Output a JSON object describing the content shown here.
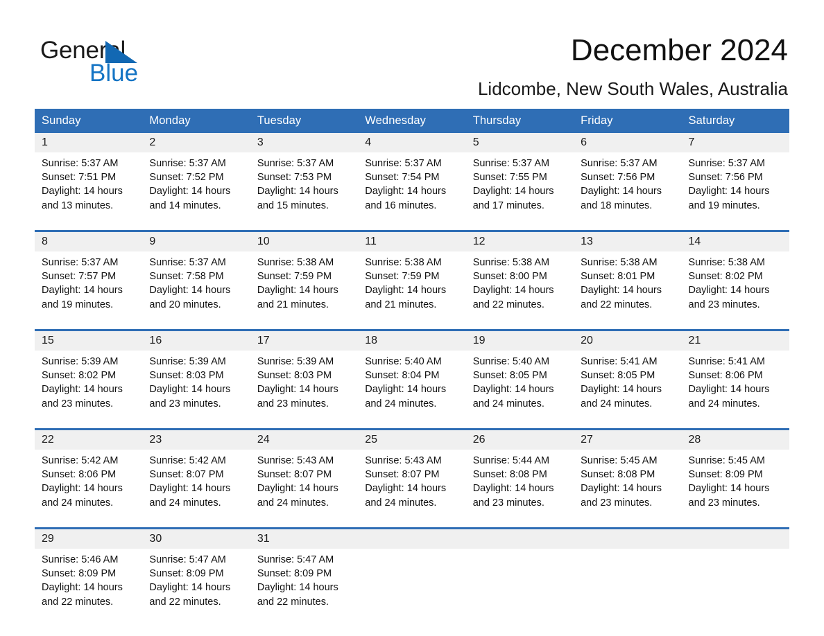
{
  "brand": {
    "name_part1": "General",
    "name_part2": "Blue",
    "accent_color": "#1474c4",
    "triangle_color": "#1268b3"
  },
  "header": {
    "title": "December 2024",
    "subtitle": "Lidcombe, New South Wales, Australia"
  },
  "calendar": {
    "header_color": "#2f6eb5",
    "weekday_headers": [
      "Sunday",
      "Monday",
      "Tuesday",
      "Wednesday",
      "Thursday",
      "Friday",
      "Saturday"
    ],
    "weeks": [
      [
        {
          "day": "1",
          "sunrise": "Sunrise: 5:37 AM",
          "sunset": "Sunset: 7:51 PM",
          "daylight_line1": "Daylight: 14 hours",
          "daylight_line2": "and 13 minutes."
        },
        {
          "day": "2",
          "sunrise": "Sunrise: 5:37 AM",
          "sunset": "Sunset: 7:52 PM",
          "daylight_line1": "Daylight: 14 hours",
          "daylight_line2": "and 14 minutes."
        },
        {
          "day": "3",
          "sunrise": "Sunrise: 5:37 AM",
          "sunset": "Sunset: 7:53 PM",
          "daylight_line1": "Daylight: 14 hours",
          "daylight_line2": "and 15 minutes."
        },
        {
          "day": "4",
          "sunrise": "Sunrise: 5:37 AM",
          "sunset": "Sunset: 7:54 PM",
          "daylight_line1": "Daylight: 14 hours",
          "daylight_line2": "and 16 minutes."
        },
        {
          "day": "5",
          "sunrise": "Sunrise: 5:37 AM",
          "sunset": "Sunset: 7:55 PM",
          "daylight_line1": "Daylight: 14 hours",
          "daylight_line2": "and 17 minutes."
        },
        {
          "day": "6",
          "sunrise": "Sunrise: 5:37 AM",
          "sunset": "Sunset: 7:56 PM",
          "daylight_line1": "Daylight: 14 hours",
          "daylight_line2": "and 18 minutes."
        },
        {
          "day": "7",
          "sunrise": "Sunrise: 5:37 AM",
          "sunset": "Sunset: 7:56 PM",
          "daylight_line1": "Daylight: 14 hours",
          "daylight_line2": "and 19 minutes."
        }
      ],
      [
        {
          "day": "8",
          "sunrise": "Sunrise: 5:37 AM",
          "sunset": "Sunset: 7:57 PM",
          "daylight_line1": "Daylight: 14 hours",
          "daylight_line2": "and 19 minutes."
        },
        {
          "day": "9",
          "sunrise": "Sunrise: 5:37 AM",
          "sunset": "Sunset: 7:58 PM",
          "daylight_line1": "Daylight: 14 hours",
          "daylight_line2": "and 20 minutes."
        },
        {
          "day": "10",
          "sunrise": "Sunrise: 5:38 AM",
          "sunset": "Sunset: 7:59 PM",
          "daylight_line1": "Daylight: 14 hours",
          "daylight_line2": "and 21 minutes."
        },
        {
          "day": "11",
          "sunrise": "Sunrise: 5:38 AM",
          "sunset": "Sunset: 7:59 PM",
          "daylight_line1": "Daylight: 14 hours",
          "daylight_line2": "and 21 minutes."
        },
        {
          "day": "12",
          "sunrise": "Sunrise: 5:38 AM",
          "sunset": "Sunset: 8:00 PM",
          "daylight_line1": "Daylight: 14 hours",
          "daylight_line2": "and 22 minutes."
        },
        {
          "day": "13",
          "sunrise": "Sunrise: 5:38 AM",
          "sunset": "Sunset: 8:01 PM",
          "daylight_line1": "Daylight: 14 hours",
          "daylight_line2": "and 22 minutes."
        },
        {
          "day": "14",
          "sunrise": "Sunrise: 5:38 AM",
          "sunset": "Sunset: 8:02 PM",
          "daylight_line1": "Daylight: 14 hours",
          "daylight_line2": "and 23 minutes."
        }
      ],
      [
        {
          "day": "15",
          "sunrise": "Sunrise: 5:39 AM",
          "sunset": "Sunset: 8:02 PM",
          "daylight_line1": "Daylight: 14 hours",
          "daylight_line2": "and 23 minutes."
        },
        {
          "day": "16",
          "sunrise": "Sunrise: 5:39 AM",
          "sunset": "Sunset: 8:03 PM",
          "daylight_line1": "Daylight: 14 hours",
          "daylight_line2": "and 23 minutes."
        },
        {
          "day": "17",
          "sunrise": "Sunrise: 5:39 AM",
          "sunset": "Sunset: 8:03 PM",
          "daylight_line1": "Daylight: 14 hours",
          "daylight_line2": "and 23 minutes."
        },
        {
          "day": "18",
          "sunrise": "Sunrise: 5:40 AM",
          "sunset": "Sunset: 8:04 PM",
          "daylight_line1": "Daylight: 14 hours",
          "daylight_line2": "and 24 minutes."
        },
        {
          "day": "19",
          "sunrise": "Sunrise: 5:40 AM",
          "sunset": "Sunset: 8:05 PM",
          "daylight_line1": "Daylight: 14 hours",
          "daylight_line2": "and 24 minutes."
        },
        {
          "day": "20",
          "sunrise": "Sunrise: 5:41 AM",
          "sunset": "Sunset: 8:05 PM",
          "daylight_line1": "Daylight: 14 hours",
          "daylight_line2": "and 24 minutes."
        },
        {
          "day": "21",
          "sunrise": "Sunrise: 5:41 AM",
          "sunset": "Sunset: 8:06 PM",
          "daylight_line1": "Daylight: 14 hours",
          "daylight_line2": "and 24 minutes."
        }
      ],
      [
        {
          "day": "22",
          "sunrise": "Sunrise: 5:42 AM",
          "sunset": "Sunset: 8:06 PM",
          "daylight_line1": "Daylight: 14 hours",
          "daylight_line2": "and 24 minutes."
        },
        {
          "day": "23",
          "sunrise": "Sunrise: 5:42 AM",
          "sunset": "Sunset: 8:07 PM",
          "daylight_line1": "Daylight: 14 hours",
          "daylight_line2": "and 24 minutes."
        },
        {
          "day": "24",
          "sunrise": "Sunrise: 5:43 AM",
          "sunset": "Sunset: 8:07 PM",
          "daylight_line1": "Daylight: 14 hours",
          "daylight_line2": "and 24 minutes."
        },
        {
          "day": "25",
          "sunrise": "Sunrise: 5:43 AM",
          "sunset": "Sunset: 8:07 PM",
          "daylight_line1": "Daylight: 14 hours",
          "daylight_line2": "and 24 minutes."
        },
        {
          "day": "26",
          "sunrise": "Sunrise: 5:44 AM",
          "sunset": "Sunset: 8:08 PM",
          "daylight_line1": "Daylight: 14 hours",
          "daylight_line2": "and 23 minutes."
        },
        {
          "day": "27",
          "sunrise": "Sunrise: 5:45 AM",
          "sunset": "Sunset: 8:08 PM",
          "daylight_line1": "Daylight: 14 hours",
          "daylight_line2": "and 23 minutes."
        },
        {
          "day": "28",
          "sunrise": "Sunrise: 5:45 AM",
          "sunset": "Sunset: 8:09 PM",
          "daylight_line1": "Daylight: 14 hours",
          "daylight_line2": "and 23 minutes."
        }
      ],
      [
        {
          "day": "29",
          "sunrise": "Sunrise: 5:46 AM",
          "sunset": "Sunset: 8:09 PM",
          "daylight_line1": "Daylight: 14 hours",
          "daylight_line2": "and 22 minutes."
        },
        {
          "day": "30",
          "sunrise": "Sunrise: 5:47 AM",
          "sunset": "Sunset: 8:09 PM",
          "daylight_line1": "Daylight: 14 hours",
          "daylight_line2": "and 22 minutes."
        },
        {
          "day": "31",
          "sunrise": "Sunrise: 5:47 AM",
          "sunset": "Sunset: 8:09 PM",
          "daylight_line1": "Daylight: 14 hours",
          "daylight_line2": "and 22 minutes."
        },
        {
          "day": "",
          "sunrise": "",
          "sunset": "",
          "daylight_line1": "",
          "daylight_line2": ""
        },
        {
          "day": "",
          "sunrise": "",
          "sunset": "",
          "daylight_line1": "",
          "daylight_line2": ""
        },
        {
          "day": "",
          "sunrise": "",
          "sunset": "",
          "daylight_line1": "",
          "daylight_line2": ""
        },
        {
          "day": "",
          "sunrise": "",
          "sunset": "",
          "daylight_line1": "",
          "daylight_line2": ""
        }
      ]
    ]
  }
}
